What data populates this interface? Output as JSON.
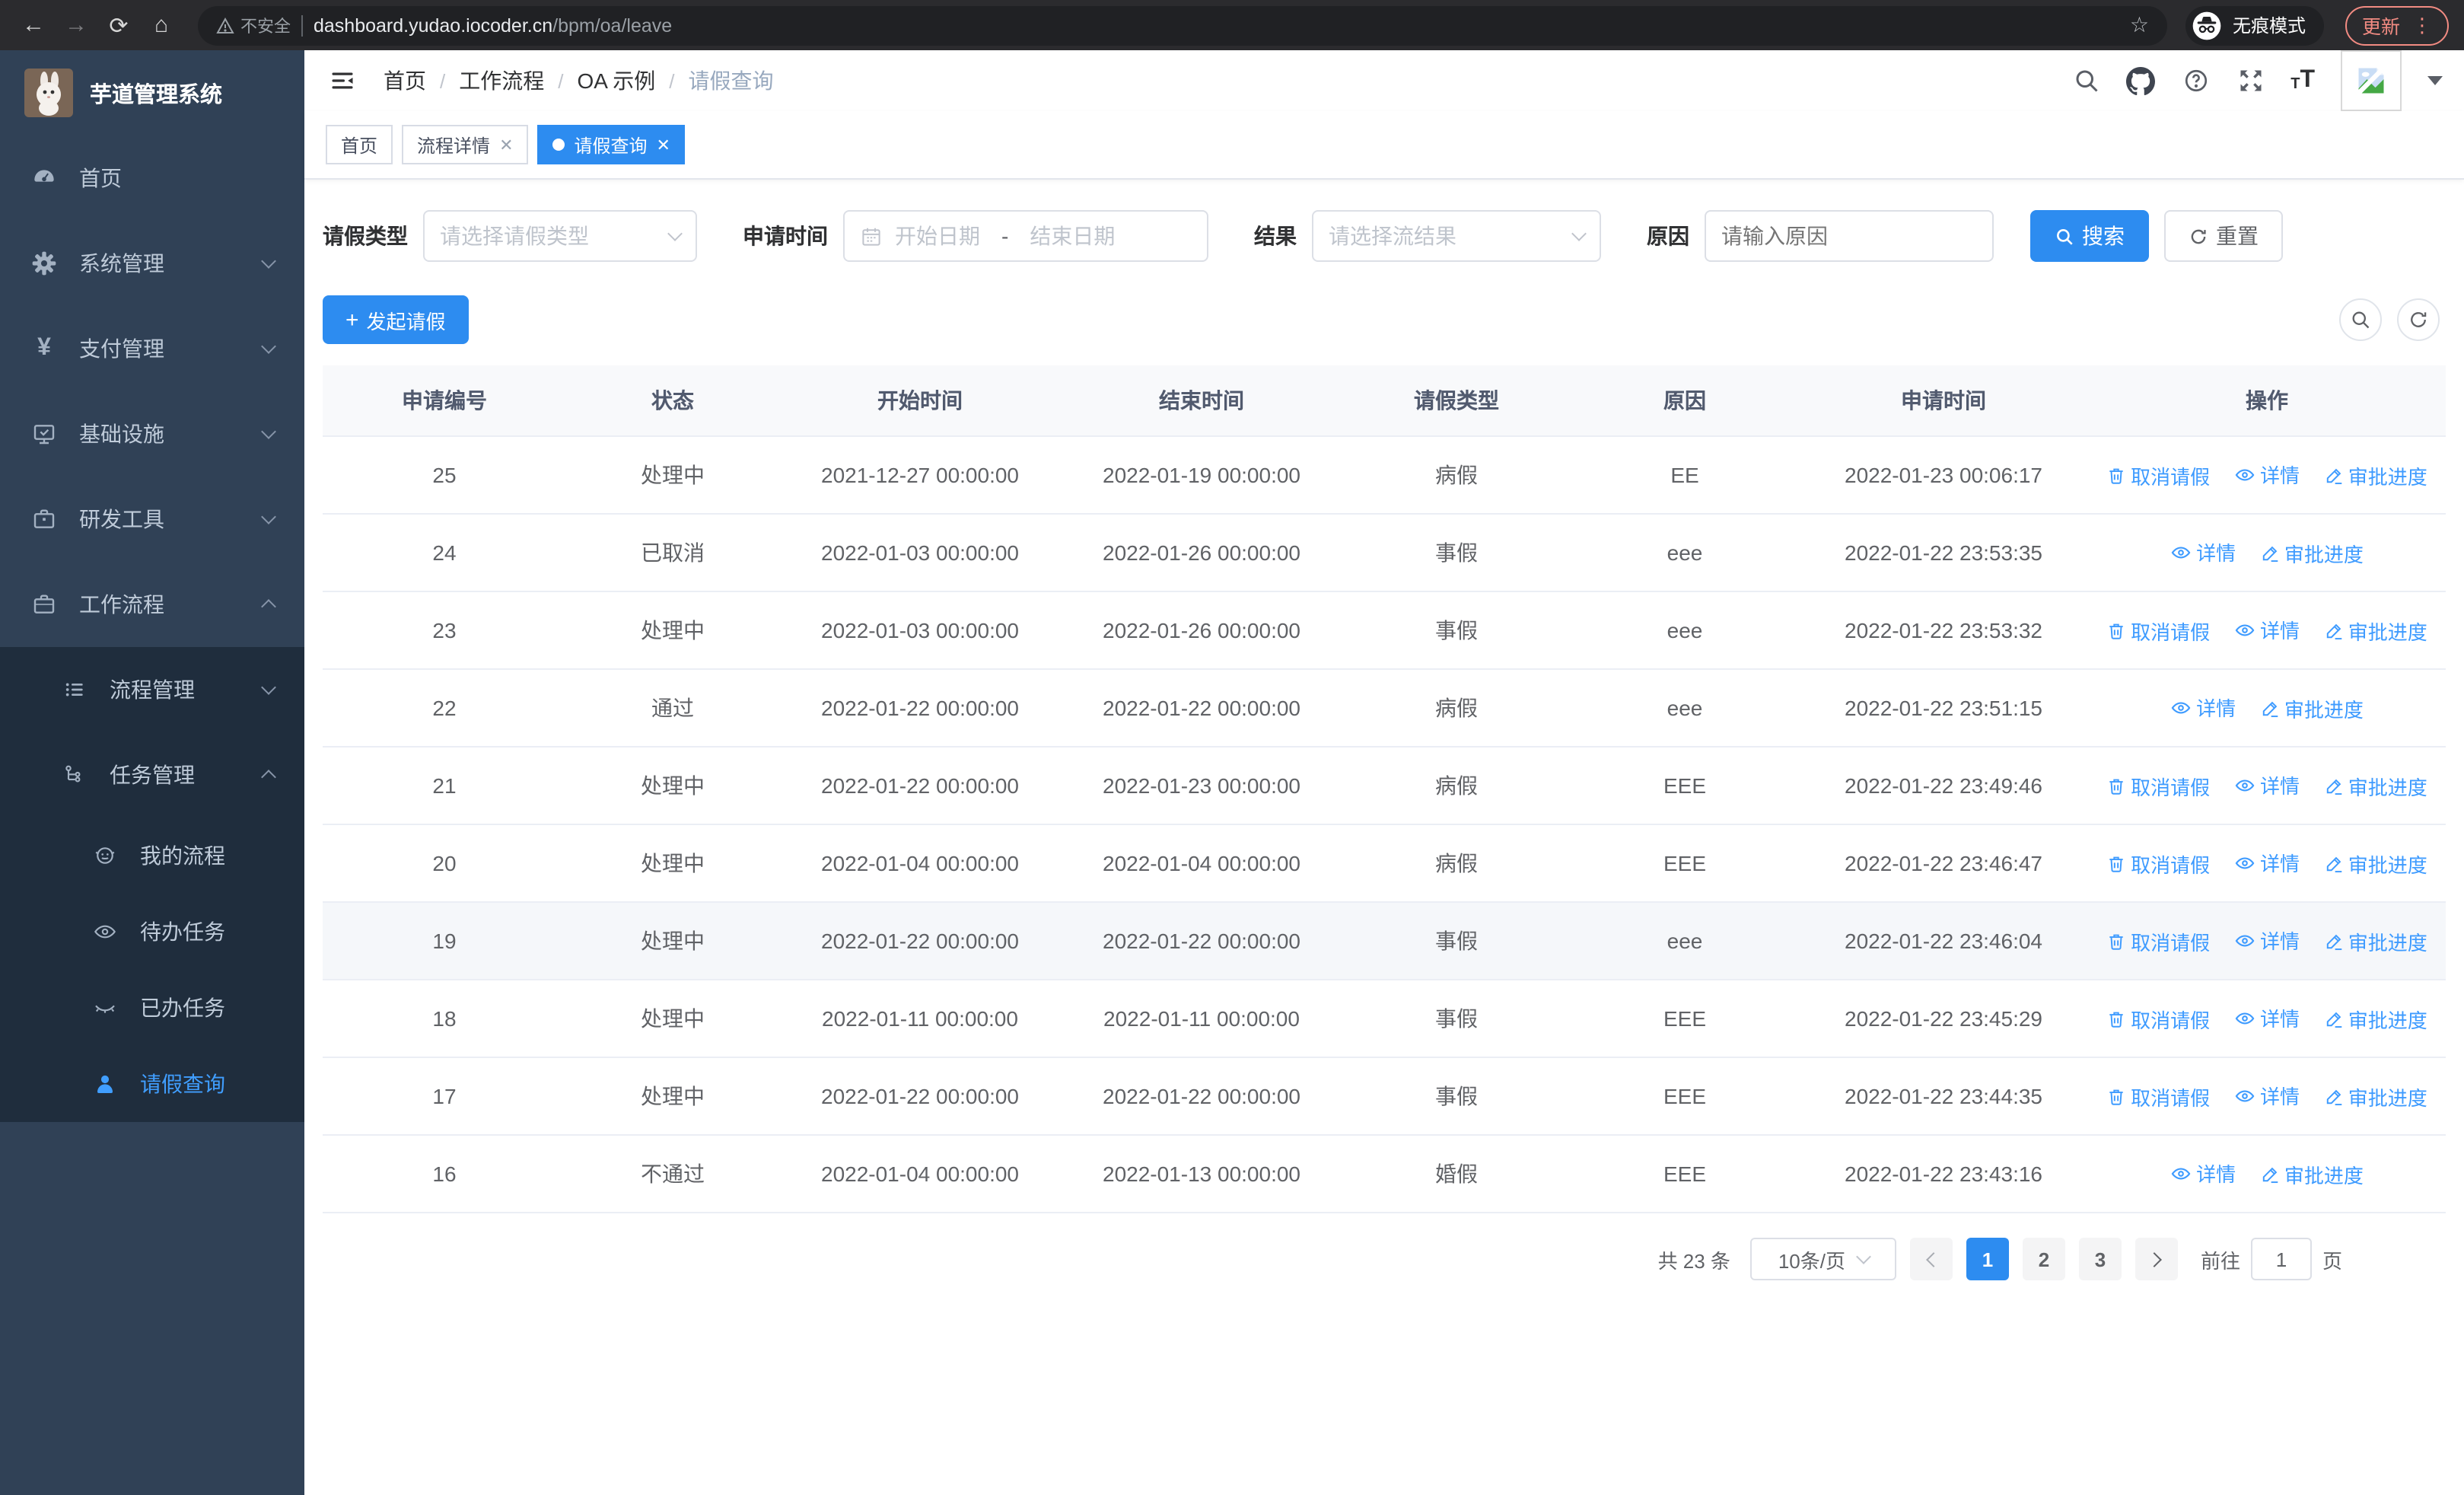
{
  "browser": {
    "security_label": "不安全",
    "url_host": "dashboard.yudao.iocoder.cn",
    "url_path": "/bpm/oa/leave",
    "incognito_label": "无痕模式",
    "update_label": "更新"
  },
  "header": {
    "breadcrumb": {
      "items": [
        "首页",
        "工作流程",
        "OA 示例",
        "请假查询"
      ],
      "separator": "/"
    }
  },
  "tabs": [
    {
      "label": "首页",
      "closable": false,
      "active": false
    },
    {
      "label": "流程详情",
      "closable": true,
      "active": false
    },
    {
      "label": "请假查询",
      "closable": true,
      "active": true
    }
  ],
  "sidebar": {
    "app_title": "芋道管理系统",
    "items": [
      {
        "label": "首页",
        "icon": "dashboard-icon"
      },
      {
        "label": "系统管理",
        "icon": "gear-icon",
        "has_children": true
      },
      {
        "label": "支付管理",
        "icon": "yen-icon",
        "has_children": true
      },
      {
        "label": "基础设施",
        "icon": "monitor-icon",
        "has_children": true
      },
      {
        "label": "研发工具",
        "icon": "toolbox-icon",
        "has_children": true
      },
      {
        "label": "工作流程",
        "icon": "briefcase-icon",
        "has_children": true,
        "expanded": true,
        "children": [
          {
            "label": "流程管理",
            "icon": "flow-list-icon",
            "has_children": true
          },
          {
            "label": "任务管理",
            "icon": "task-tree-icon",
            "has_children": true,
            "expanded": true,
            "children": [
              {
                "label": "我的流程",
                "icon": "face-icon"
              },
              {
                "label": "待办任务",
                "icon": "eye-icon"
              },
              {
                "label": "已办任务",
                "icon": "eye-closed-icon"
              },
              {
                "label": "请假查询",
                "icon": "user-icon",
                "active": true
              }
            ]
          }
        ]
      }
    ]
  },
  "filters": {
    "leave_type": {
      "label": "请假类型",
      "placeholder": "请选择请假类型"
    },
    "apply_time": {
      "label": "申请时间",
      "start_placeholder": "开始日期",
      "separator": "-",
      "end_placeholder": "结束日期"
    },
    "result": {
      "label": "结果",
      "placeholder": "请选择流结果"
    },
    "reason": {
      "label": "原因",
      "placeholder": "请输入原因"
    },
    "search_label": "搜索",
    "reset_label": "重置"
  },
  "toolbar": {
    "create_label": "发起请假"
  },
  "table": {
    "columns": [
      "申请编号",
      "状态",
      "开始时间",
      "结束时间",
      "请假类型",
      "原因",
      "申请时间",
      "操作"
    ],
    "action_labels": {
      "cancel": "取消请假",
      "detail": "详情",
      "progress": "审批进度"
    },
    "rows": [
      {
        "id": "25",
        "status": "处理中",
        "start": "2021-12-27 00:00:00",
        "end": "2022-01-19 00:00:00",
        "type": "病假",
        "reason": "EE",
        "applied": "2022-01-23 00:06:17",
        "actions": [
          "cancel",
          "detail",
          "progress"
        ],
        "highlighted": false
      },
      {
        "id": "24",
        "status": "已取消",
        "start": "2022-01-03 00:00:00",
        "end": "2022-01-26 00:00:00",
        "type": "事假",
        "reason": "eee",
        "applied": "2022-01-22 23:53:35",
        "actions": [
          "detail",
          "progress"
        ],
        "highlighted": false
      },
      {
        "id": "23",
        "status": "处理中",
        "start": "2022-01-03 00:00:00",
        "end": "2022-01-26 00:00:00",
        "type": "事假",
        "reason": "eee",
        "applied": "2022-01-22 23:53:32",
        "actions": [
          "cancel",
          "detail",
          "progress"
        ],
        "highlighted": false
      },
      {
        "id": "22",
        "status": "通过",
        "start": "2022-01-22 00:00:00",
        "end": "2022-01-22 00:00:00",
        "type": "病假",
        "reason": "eee",
        "applied": "2022-01-22 23:51:15",
        "actions": [
          "detail",
          "progress"
        ],
        "highlighted": false
      },
      {
        "id": "21",
        "status": "处理中",
        "start": "2022-01-22 00:00:00",
        "end": "2022-01-23 00:00:00",
        "type": "病假",
        "reason": "EEE",
        "applied": "2022-01-22 23:49:46",
        "actions": [
          "cancel",
          "detail",
          "progress"
        ],
        "highlighted": false
      },
      {
        "id": "20",
        "status": "处理中",
        "start": "2022-01-04 00:00:00",
        "end": "2022-01-04 00:00:00",
        "type": "病假",
        "reason": "EEE",
        "applied": "2022-01-22 23:46:47",
        "actions": [
          "cancel",
          "detail",
          "progress"
        ],
        "highlighted": false
      },
      {
        "id": "19",
        "status": "处理中",
        "start": "2022-01-22 00:00:00",
        "end": "2022-01-22 00:00:00",
        "type": "事假",
        "reason": "eee",
        "applied": "2022-01-22 23:46:04",
        "actions": [
          "cancel",
          "detail",
          "progress"
        ],
        "highlighted": true
      },
      {
        "id": "18",
        "status": "处理中",
        "start": "2022-01-11 00:00:00",
        "end": "2022-01-11 00:00:00",
        "type": "事假",
        "reason": "EEE",
        "applied": "2022-01-22 23:45:29",
        "actions": [
          "cancel",
          "detail",
          "progress"
        ],
        "highlighted": false
      },
      {
        "id": "17",
        "status": "处理中",
        "start": "2022-01-22 00:00:00",
        "end": "2022-01-22 00:00:00",
        "type": "事假",
        "reason": "EEE",
        "applied": "2022-01-22 23:44:35",
        "actions": [
          "cancel",
          "detail",
          "progress"
        ],
        "highlighted": false
      },
      {
        "id": "16",
        "status": "不通过",
        "start": "2022-01-04 00:00:00",
        "end": "2022-01-13 00:00:00",
        "type": "婚假",
        "reason": "EEE",
        "applied": "2022-01-22 23:43:16",
        "actions": [
          "detail",
          "progress"
        ],
        "highlighted": false
      }
    ]
  },
  "pagination": {
    "total_label": "共 23 条",
    "page_size_label": "10条/页",
    "pages": [
      "1",
      "2",
      "3"
    ],
    "active_page": "1",
    "jump_prefix": "前往",
    "jump_value": "1",
    "jump_suffix": "页"
  },
  "icons": {
    "back-icon": "←",
    "forward-icon": "→",
    "reload-icon": "⟳",
    "home-icon": "⌂",
    "warning-icon": "triangle-exclamation",
    "star-icon": "☆",
    "incognito-icon": "hat-and-glasses",
    "more-dots-icon": "⋮",
    "hamburger-icon": "fold-menu",
    "search-icon": "magnifier",
    "github-icon": "octocat",
    "help-icon": "circle-question",
    "fullscreen-icon": "expand-arrows",
    "font-size-icon": "tT",
    "avatar": "broken-image",
    "calendar-icon": "calendar",
    "refresh-icon": "circular-arrow",
    "plus-icon": "+",
    "trash-icon": "trash-bin",
    "eye-icon": "eye",
    "pen-icon": "pen"
  },
  "colors": {
    "primary": "#2d8cf0",
    "link": "#3e9bff",
    "sidebar_bg": "#304156",
    "submenu_bg": "#1f2d3d",
    "sidebar_text": "#bfcbd9",
    "chrome_bg": "#2b2b2e",
    "address_bg": "#202124",
    "update_accent": "#f28b82",
    "row_highlight": "#f5f7fa",
    "table_header_bg": "#f8f9fb",
    "border": "#ebeef5"
  }
}
